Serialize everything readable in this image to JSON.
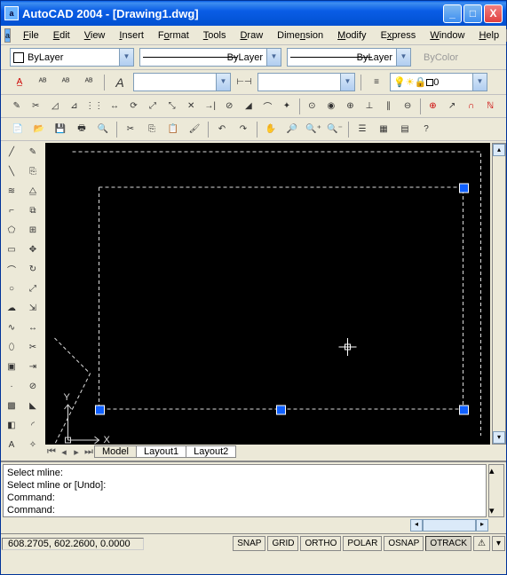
{
  "title": "AutoCAD 2004 - [Drawing1.dwg]",
  "menu": {
    "file": "File",
    "edit": "Edit",
    "view": "View",
    "insert": "Insert",
    "format": "Format",
    "tools": "Tools",
    "draw": "Draw",
    "dimension": "Dimension",
    "modify": "Modify",
    "express": "Express",
    "window": "Window",
    "help": "Help"
  },
  "props": {
    "layer": "ByLayer",
    "linetype": "ByLayer",
    "lineweight": "ByLayer",
    "bycolor": "ByColor",
    "layer_state_value": "0"
  },
  "tabs": {
    "model": "Model",
    "layout1": "Layout1",
    "layout2": "Layout2"
  },
  "cmd": {
    "l1": "Select mline:",
    "l2": "Select mline or [Undo]:",
    "l3": "Command:",
    "l4": "Command:"
  },
  "status": {
    "coords": "608.2705, 602.2600, 0.0000",
    "snap": "SNAP",
    "grid": "GRID",
    "ortho": "ORTHO",
    "polar": "POLAR",
    "osnap": "OSNAP",
    "otrack": "OTRACK"
  },
  "ucs": {
    "x": "X",
    "y": "Y"
  }
}
